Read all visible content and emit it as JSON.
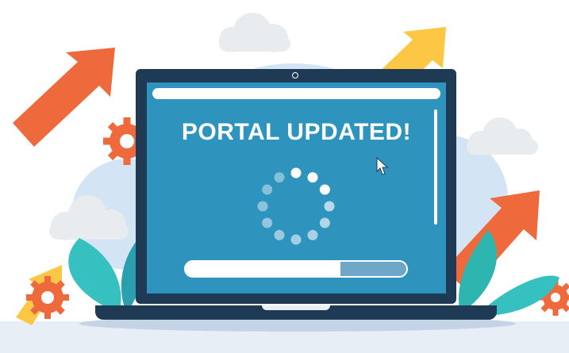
{
  "status": {
    "title": "PORTAL UPDATED!",
    "progress_fraction": 0.7
  },
  "colors": {
    "screen": "#2e93bd",
    "bezel": "#1e3a55",
    "arrow_orange": "#ee6a3c",
    "arrow_yellow": "#fcc745",
    "gear_orange": "#ee6a3c",
    "leaf_teal": "#2fb5b0",
    "cloud": "#e9ecef"
  },
  "icons": [
    "arrow-up-icon",
    "gear-icon",
    "cloud-icon",
    "loading-spinner-icon",
    "cursor-icon",
    "leaf-icon"
  ]
}
